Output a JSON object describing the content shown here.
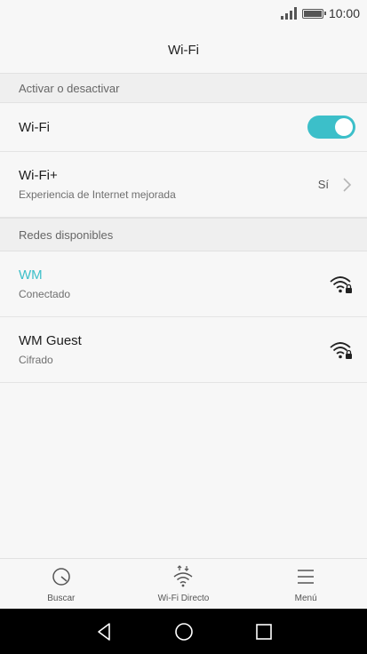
{
  "status": {
    "time": "10:00",
    "icons": [
      "signal-icon",
      "battery-icon"
    ]
  },
  "header": {
    "title": "Wi-Fi"
  },
  "sections": {
    "toggle_header": "Activar o desactivar",
    "networks_header": "Redes disponibles"
  },
  "wifi_row": {
    "title": "Wi-Fi",
    "toggle_on": true
  },
  "wifi_plus": {
    "title": "Wi-Fi+",
    "subtitle": "Experiencia de Internet mejorada",
    "value": "Sí"
  },
  "networks": [
    {
      "name": "WM",
      "status": "Conectado",
      "connected": true,
      "icon": "wifi-lock-icon"
    },
    {
      "name": "WM Guest",
      "status": "Cifrado",
      "connected": false,
      "icon": "wifi-lock-icon"
    }
  ],
  "bottom_bar": {
    "scan_label": "Buscar",
    "direct_label": "Wi-Fi Directo",
    "menu_label": "Menú"
  },
  "colors": {
    "accent": "#3cbfc9",
    "background": "#f7f7f7",
    "section": "#efefef"
  }
}
